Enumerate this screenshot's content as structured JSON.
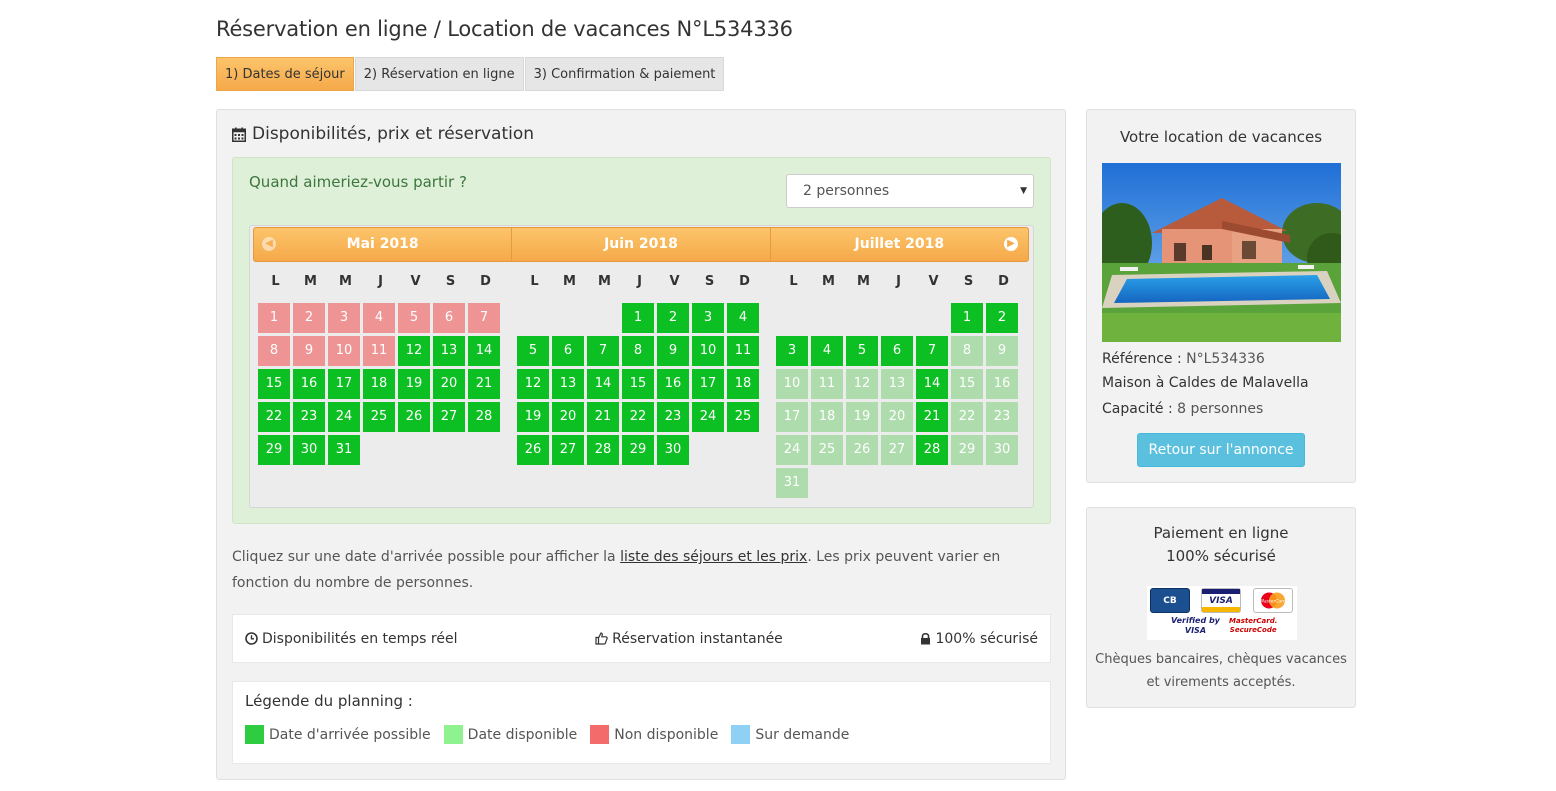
{
  "page": {
    "title": "Réservation en ligne / Location de vacances N°L534336"
  },
  "steps": [
    {
      "label": "1) Dates de séjour",
      "active": true
    },
    {
      "label": "2) Réservation en ligne",
      "active": false
    },
    {
      "label": "3) Confirmation & paiement",
      "active": false
    }
  ],
  "availability": {
    "heading": "Disponibilités, prix et réservation",
    "question": "Quand aimeriez-vous partir ?",
    "persons_select": {
      "value": "2 personnes"
    }
  },
  "calendar": {
    "weekdays": [
      "L",
      "M",
      "M",
      "J",
      "V",
      "S",
      "D"
    ],
    "colors": {
      "arrival": "#0cbf23",
      "available": "#aedcad",
      "unavailable": "#ef9494",
      "on_request": "#8fd0f5"
    },
    "months": [
      {
        "title": "Mai 2018",
        "first_weekday": 1,
        "days": 31,
        "unavailable": [
          1,
          2,
          3,
          4,
          5,
          6,
          7,
          8,
          9,
          10,
          11
        ],
        "available": [],
        "arrival": [
          12,
          13,
          14,
          15,
          16,
          17,
          18,
          19,
          20,
          21,
          22,
          23,
          24,
          25,
          26,
          27,
          28,
          29,
          30,
          31
        ]
      },
      {
        "title": "Juin 2018",
        "first_weekday": 4,
        "days": 30,
        "unavailable": [],
        "available": [],
        "arrival": [
          1,
          2,
          3,
          4,
          5,
          6,
          7,
          8,
          9,
          10,
          11,
          12,
          13,
          14,
          15,
          16,
          17,
          18,
          19,
          20,
          21,
          22,
          23,
          24,
          25,
          26,
          27,
          28,
          29,
          30
        ]
      },
      {
        "title": "Juillet 2018",
        "first_weekday": 6,
        "days": 31,
        "unavailable": [],
        "available": [
          8,
          9,
          10,
          11,
          12,
          13,
          15,
          16,
          17,
          18,
          19,
          20,
          22,
          23,
          24,
          25,
          26,
          27,
          29,
          30,
          31
        ],
        "arrival": [
          1,
          2,
          3,
          4,
          5,
          6,
          7,
          14,
          21,
          28
        ]
      }
    ]
  },
  "help": {
    "text_before": "Cliquez sur une date d'arrivée possible pour afficher la ",
    "link": "liste des séjours et les prix",
    "text_after": ". Les prix peuvent varier en fonction du nombre de personnes."
  },
  "features": [
    {
      "icon": "clock-icon",
      "label": "Disponibilités en temps réel"
    },
    {
      "icon": "thumbs-up-icon",
      "label": "Réservation instantanée"
    },
    {
      "icon": "lock-icon",
      "label": "100% sécurisé"
    }
  ],
  "legend": {
    "title": "Légende du planning :",
    "items": [
      {
        "label": "Date d'arrivée possible",
        "color": "#2ecc40"
      },
      {
        "label": "Date disponible",
        "color": "#8ef28e"
      },
      {
        "label": "Non disponible",
        "color": "#f46b6b"
      },
      {
        "label": "Sur demande",
        "color": "#8fd0f5"
      }
    ]
  },
  "rental": {
    "title": "Votre location de vacances",
    "reference_label": "Référence :",
    "reference_value": "N°L534336",
    "type": "Maison à Caldes de Malavella",
    "capacity_label": "Capacité :",
    "capacity_value": "8 personnes",
    "back_button": "Retour sur l'annonce"
  },
  "payment": {
    "title_line1": "Paiement en ligne",
    "title_line2": "100% sécurisé",
    "cards": [
      "CB",
      "VISA",
      "MasterCard"
    ],
    "vbv_line1": "Verified by",
    "vbv_line2": "VISA",
    "msc_line1": "MasterCard.",
    "msc_line2": "SecureCode",
    "note_line1": "Chèques bancaires, chèques vacances",
    "note_line2": "et virements acceptés."
  }
}
